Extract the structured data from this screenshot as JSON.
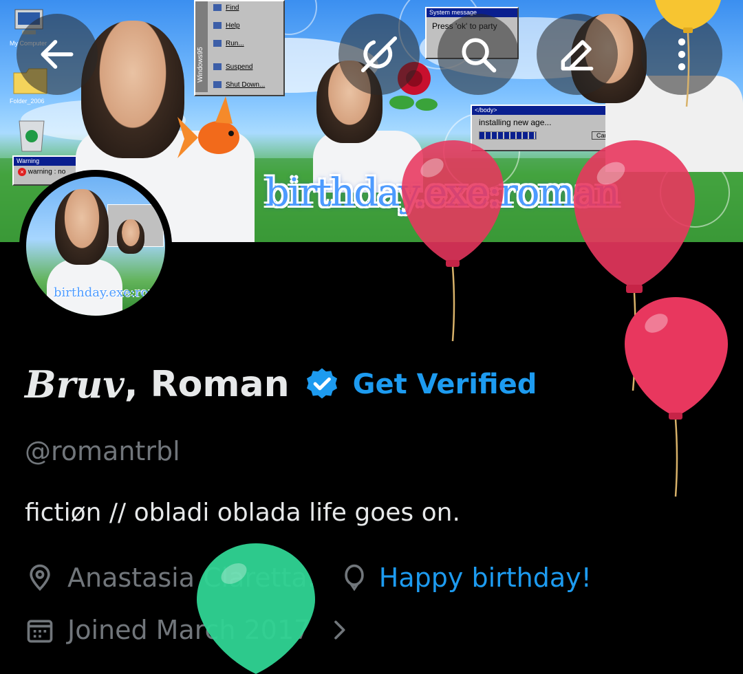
{
  "banner": {
    "title": "birthday.exe:roman",
    "start_menu": {
      "os_label": "Windows95",
      "items": [
        "Find",
        "Help",
        "Run...",
        "Suspend",
        "Shut Down..."
      ]
    },
    "windows": {
      "system_message": {
        "title": "System message",
        "text": "Press 'ok' to party"
      },
      "installing": {
        "title": "</body>",
        "text": "installing new age...",
        "button": "Cancel"
      },
      "warning": {
        "title": "Warning",
        "text": "warning : no"
      }
    },
    "desktop_icons": [
      "My Computer",
      "Folder_2006",
      "Recycle Bin"
    ]
  },
  "topbar": {
    "back_icon": "arrow-left-icon",
    "grok_icon": "grok-icon",
    "search_icon": "search-icon",
    "compose_icon": "edit-icon",
    "more_icon": "more-vertical-icon"
  },
  "avatar": {
    "title": "birthday.exe:roman"
  },
  "profile": {
    "name_styled": "Bruv",
    "name_rest": ", Roman",
    "get_verified": "Get Verified",
    "handle": "@romantrbl",
    "bio": "fictiøn // obladi oblada life goes on.",
    "location": "Anastasia Claretta.",
    "birthday_link": "Happy birthday!",
    "joined": "Joined March 2017"
  },
  "colors": {
    "accent": "#1d9bf0",
    "muted": "#71767b",
    "text": "#e7e9ea",
    "background": "#000000",
    "balloon_red": "#e8375e",
    "balloon_green": "#2fd494"
  }
}
